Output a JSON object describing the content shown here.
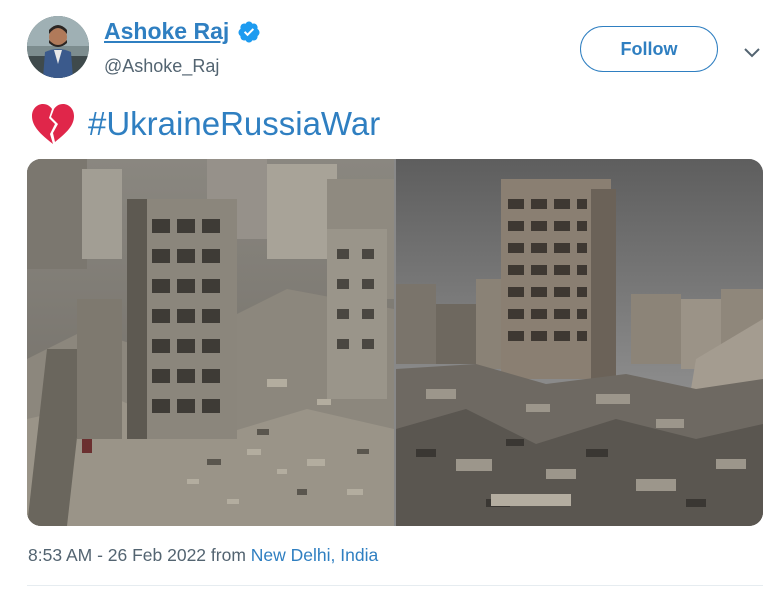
{
  "tweet": {
    "author": {
      "display_name": "Ashoke Raj",
      "handle": "@Ashoke_Raj",
      "verified": true
    },
    "follow_label": "Follow",
    "more_icon": "chevron-down-icon",
    "text": {
      "emoji": "broken-heart",
      "hashtag": "#UkraineRussiaWar"
    },
    "media": [
      {
        "icon": "photo-destroyed-buildings-aerial"
      },
      {
        "icon": "photo-destroyed-buildings-street"
      }
    ],
    "meta": {
      "timestamp": "8:53 AM - 26 Feb 2022",
      "from": " from ",
      "location": "New Delhi, India"
    }
  },
  "colors": {
    "link": "#2f7fc1",
    "muted": "#536471",
    "heart": "#e0264a",
    "verified": "#1d9bf0"
  }
}
